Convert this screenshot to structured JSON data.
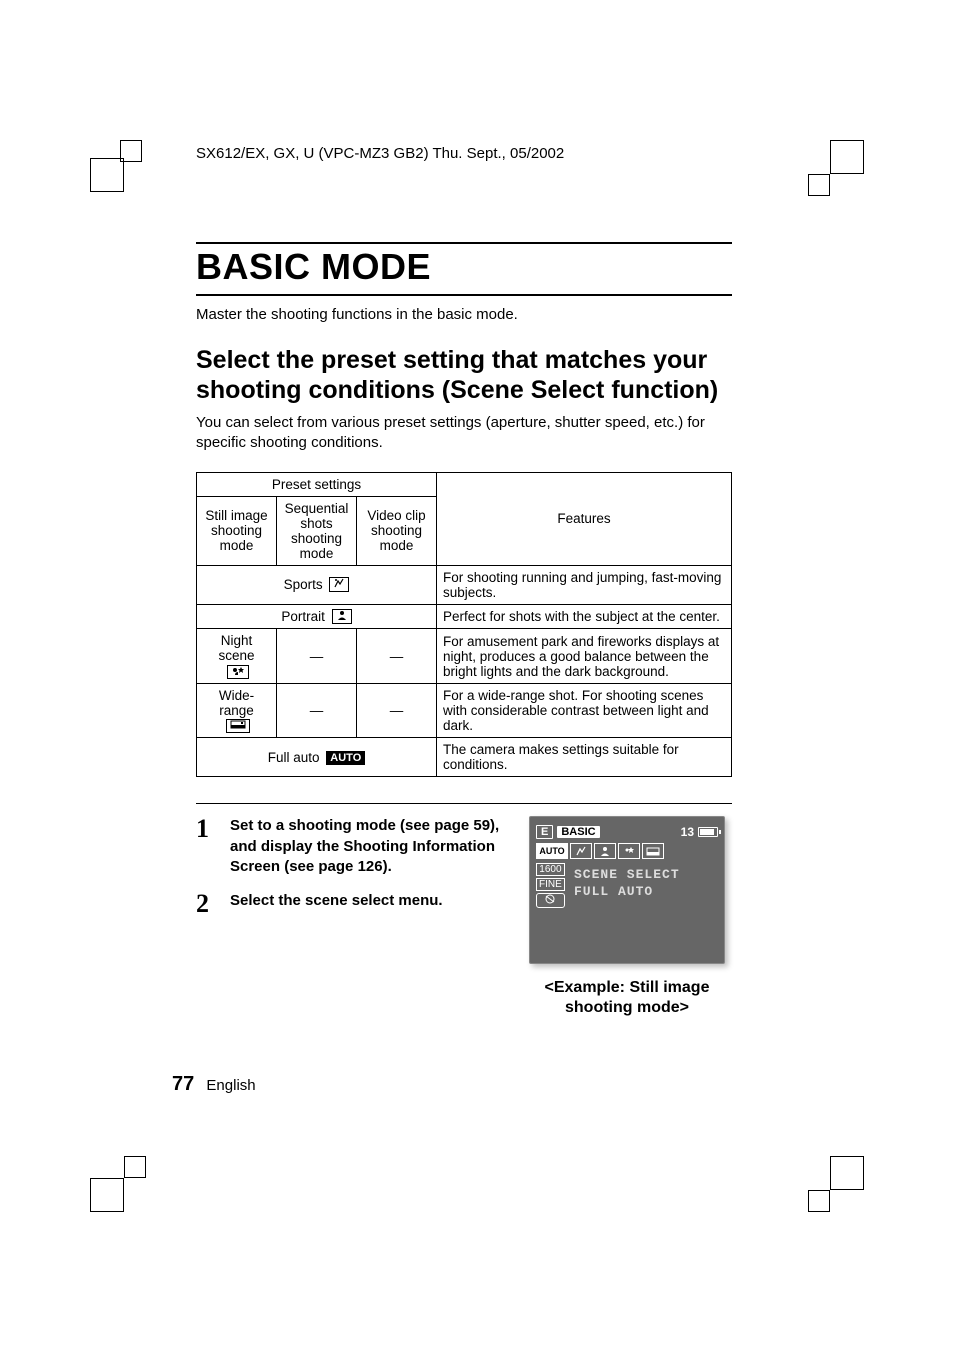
{
  "header": {
    "doc_ref": "SX612/EX, GX, U (VPC-MZ3 GB2)    Thu. Sept., 05/2002"
  },
  "title": "BASIC MODE",
  "intro": "Master the shooting functions in the basic mode.",
  "subtitle": "Select the preset setting that matches your shooting conditions (Scene Select function)",
  "subintro": "You can select from various preset settings (aperture, shutter speed, etc.) for specific shooting conditions.",
  "table": {
    "head": {
      "preset": "Preset settings",
      "col1": "Still image shooting mode",
      "col2": "Sequential shots shooting mode",
      "col3": "Video clip shooting mode",
      "features": "Features"
    },
    "rows": [
      {
        "label": "Sports",
        "icon": "sports-icon",
        "span3": true,
        "feature": "For shooting running and jumping, fast-moving subjects."
      },
      {
        "label": "Portrait",
        "icon": "portrait-icon",
        "span3": true,
        "feature": "Perfect for shots with the subject at the center."
      },
      {
        "label": "Night scene",
        "icon": "night-icon",
        "col1_only": true,
        "feature": "For amusement park and fireworks displays at night, produces a good balance between the bright lights and the dark background."
      },
      {
        "label": "Wide-range",
        "icon": "wide-icon",
        "col1_only": true,
        "feature": "For a wide-range shot. For shooting scenes with considerable contrast between light and dark."
      },
      {
        "label": "Full auto",
        "icon": "auto-icon",
        "icon_text": "AUTO",
        "span3": true,
        "feature": "The camera makes settings suitable for conditions."
      }
    ],
    "dash": "—"
  },
  "steps": [
    {
      "num": "1",
      "text": "Set to a shooting mode (see page 59), and display the Shooting Information Screen (see page 126)."
    },
    {
      "num": "2",
      "text": "Select the scene select menu."
    }
  ],
  "lcd": {
    "tab_e": "E",
    "tab_basic": "BASIC",
    "count": "13",
    "auto": "AUTO",
    "res": "1600",
    "fine": "FINE",
    "menu_line1": "SCENE SELECT",
    "menu_line2": "FULL AUTO"
  },
  "caption": "<Example: Still image shooting mode>",
  "footer": {
    "page": "77",
    "lang": "English"
  }
}
